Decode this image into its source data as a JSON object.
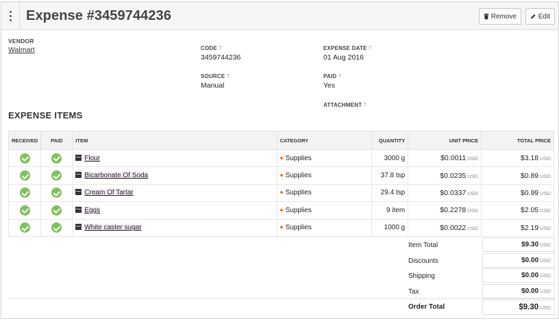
{
  "header": {
    "title": "Expense #3459744236",
    "remove_label": "Remove",
    "edit_label": "Edit"
  },
  "details": {
    "vendor_label": "VENDOR",
    "vendor_value": "Walmart",
    "code_label": "CODE",
    "code_value": "3459744236",
    "expense_date_label": "EXPENSE DATE",
    "expense_date_value": "01 Aug 2016",
    "source_label": "SOURCE",
    "source_value": "Manual",
    "paid_label": "PAID",
    "paid_value": "Yes",
    "attachment_label": "ATTACHMENT",
    "help_mark": "?"
  },
  "items_section": {
    "title": "EXPENSE ITEMS",
    "columns": [
      "RECEIVED",
      "PAID",
      "ITEM",
      "CATEGORY",
      "QUANTITY",
      "UNIT PRICE",
      "TOTAL PRICE"
    ],
    "currency": "USD",
    "rows": [
      {
        "item": "Flour",
        "category": "Supplies",
        "quantity": "3000 g",
        "unit_price": "$0.0011",
        "total_price": "$3.18"
      },
      {
        "item": "Bicarbonate Of Soda",
        "category": "Supplies",
        "quantity": "37.8 tsp",
        "unit_price": "$0.0235",
        "total_price": "$0.89"
      },
      {
        "item": "Cream Of Tartar",
        "category": "Supplies",
        "quantity": "29.4 tsp",
        "unit_price": "$0.0337",
        "total_price": "$0.99"
      },
      {
        "item": "Eggs",
        "category": "Supplies",
        "quantity": "9 item",
        "unit_price": "$0.2278",
        "total_price": "$2.05"
      },
      {
        "item": "White caster sugar",
        "category": "Supplies",
        "quantity": "1000 g",
        "unit_price": "$0.0022",
        "total_price": "$2.19"
      }
    ]
  },
  "totals": {
    "item_total_label": "Item Total",
    "item_total_value": "$9.30",
    "discounts_label": "Discounts",
    "discounts_value": "$0.00",
    "shipping_label": "Shipping",
    "shipping_value": "$0.00",
    "tax_label": "Tax",
    "tax_value": "$0.00",
    "order_total_label": "Order Total",
    "order_total_value": "$9.30",
    "currency": "USD"
  },
  "colors": {
    "check_green": "#7dc35a",
    "category_bullet": "#e67e22",
    "help_blue": "#7aa7c7"
  }
}
